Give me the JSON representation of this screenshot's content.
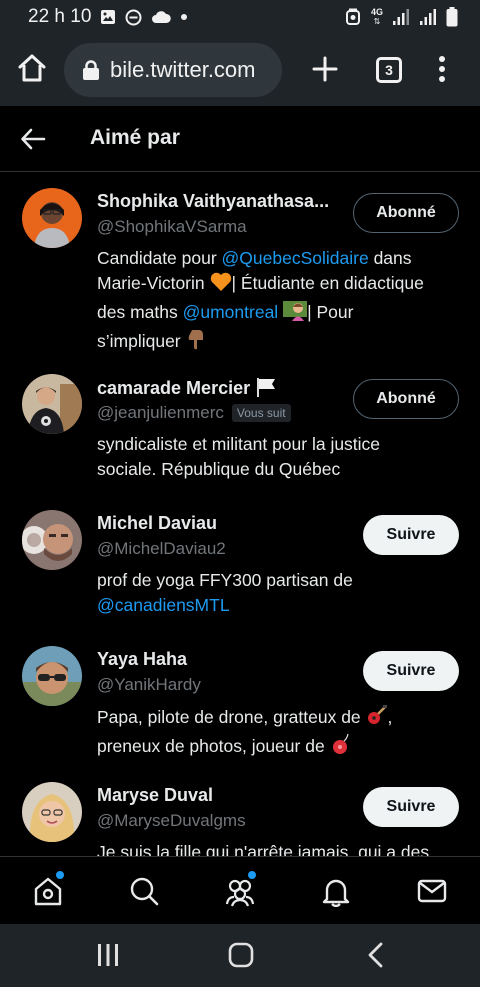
{
  "status_bar": {
    "time": "22 h 10",
    "network": "4G",
    "icons": [
      "image-icon",
      "do-not-disturb-icon",
      "cloud-icon",
      "notification-dot-icon",
      "alarm-icon",
      "signal-icon",
      "battery-icon"
    ]
  },
  "browser": {
    "url": "bile.twitter.com",
    "tab_count": "3"
  },
  "header": {
    "title": "Aimé par"
  },
  "users": [
    {
      "name": "Shophika Vaithyanathasa...",
      "handle": "@ShophikaVSarma",
      "button": "Abonné",
      "bio": {
        "line1a": "Candidate pour ",
        "mention1": "@QuebecSolidaire",
        "line1b": " dans",
        "line2a": "Marie-Victorin ",
        "line2b": "| Étudiante en didactique",
        "line3a": "des maths ",
        "mention2": "@umontreal",
        "line3b": "| Pour",
        "line4a": "s’impliquer "
      }
    },
    {
      "name": "camarade Mercier",
      "handle": "@jeanjulienmerc",
      "badge": "Vous suit",
      "button": "Abonné",
      "bio": {
        "line1": "syndicaliste et militant pour la justice",
        "line2": "sociale. République du Québec"
      }
    },
    {
      "name": "Michel Daviau",
      "handle": "@MichelDaviau2",
      "button": "Suivre",
      "bio": {
        "line1": "prof de yoga FFY300 partisan de",
        "mention": "@canadiensMTL"
      }
    },
    {
      "name": "Yaya Haha",
      "handle": "@YanikHardy",
      "button": "Suivre",
      "bio": {
        "line1": "Papa, pilote de drone, gratteux de ",
        "line1b": ",",
        "line2": "preneux de photos, joueur de "
      }
    },
    {
      "name": "Maryse Duval",
      "handle": "@MaryseDuvalgms",
      "button": "Suivre",
      "bio": {
        "line1": "Je suis la fille qui n'arrête jamais, qui a des"
      }
    }
  ],
  "bottom_nav": [
    "home-icon",
    "search-icon",
    "communities-icon",
    "notifications-icon",
    "messages-icon"
  ],
  "colors": {
    "accent": "#1d9bf0",
    "background": "#000000",
    "chrome": "#1f2428"
  }
}
